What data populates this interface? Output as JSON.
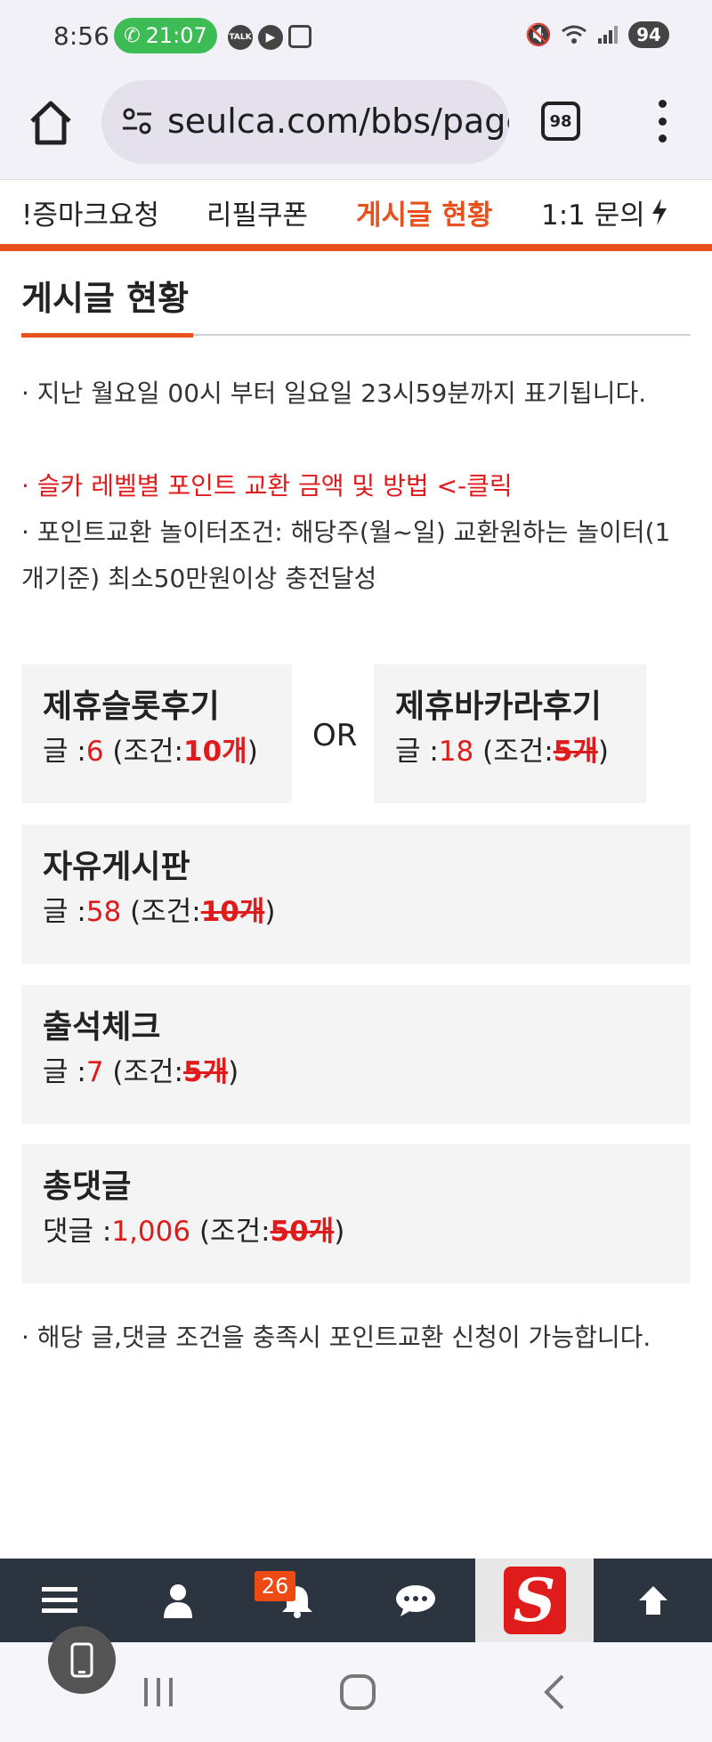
{
  "status_bar": {
    "time": "8:56",
    "call_timer": "21:07",
    "talk_icon_label": "TALK",
    "battery": "94"
  },
  "browser": {
    "url": "seulca.com/bbs/page",
    "tab_count": "98"
  },
  "site_nav": {
    "items": [
      {
        "label": "!증마크요청",
        "active": false
      },
      {
        "label": "리필쿠폰",
        "active": false
      },
      {
        "label": "게시글 현황",
        "active": true
      },
      {
        "label": "1:1 문의",
        "active": false
      }
    ]
  },
  "page": {
    "title": "게시글 현황",
    "notices": [
      "· 지난 월요일 00시 부터 일요일 23시59분까지 표기됩니다.",
      "· 슬카 레벨별 포인트 교환 금액 및 방법 <-클릭",
      "· 포인트교환 놀이터조건: 해당주(월~일) 교환원하는 놀이터(1개기준) 최소50만원이상 충전달성"
    ],
    "or_label": "OR",
    "cards": [
      {
        "title": "제휴슬롯후기",
        "prefix": "글 :",
        "count": "6",
        "cond_open": "(조건:",
        "requirement": "10개",
        "cond_close": ")",
        "met": false
      },
      {
        "title": "제휴바카라후기",
        "prefix": "글 :",
        "count": "18",
        "cond_open": "(조건:",
        "requirement": "5개",
        "cond_close": ")",
        "met": true
      },
      {
        "title": "자유게시판",
        "prefix": "글 :",
        "count": "58",
        "cond_open": "(조건:",
        "requirement": "10개",
        "cond_close": ")",
        "met": true
      },
      {
        "title": "출석체크",
        "prefix": "글 :",
        "count": "7",
        "cond_open": "(조건:",
        "requirement": "5개",
        "cond_close": ")",
        "met": true
      },
      {
        "title": "총댓글",
        "prefix": "댓글 :",
        "count": "1,006",
        "cond_open": "(조건:",
        "requirement": "50개",
        "cond_close": ")",
        "met": true
      }
    ],
    "footer_notice": "· 해당 글,댓글 조건을 충족시 포인트교환 신청이 가능합니다."
  },
  "bottom_toolbar": {
    "notification_count": "26",
    "logo_letter": "S"
  },
  "colors": {
    "accent": "#e8501c",
    "red_text": "#e01b1b",
    "card_bg": "#f4f4f4",
    "toolbar_bg": "#2c3440"
  }
}
